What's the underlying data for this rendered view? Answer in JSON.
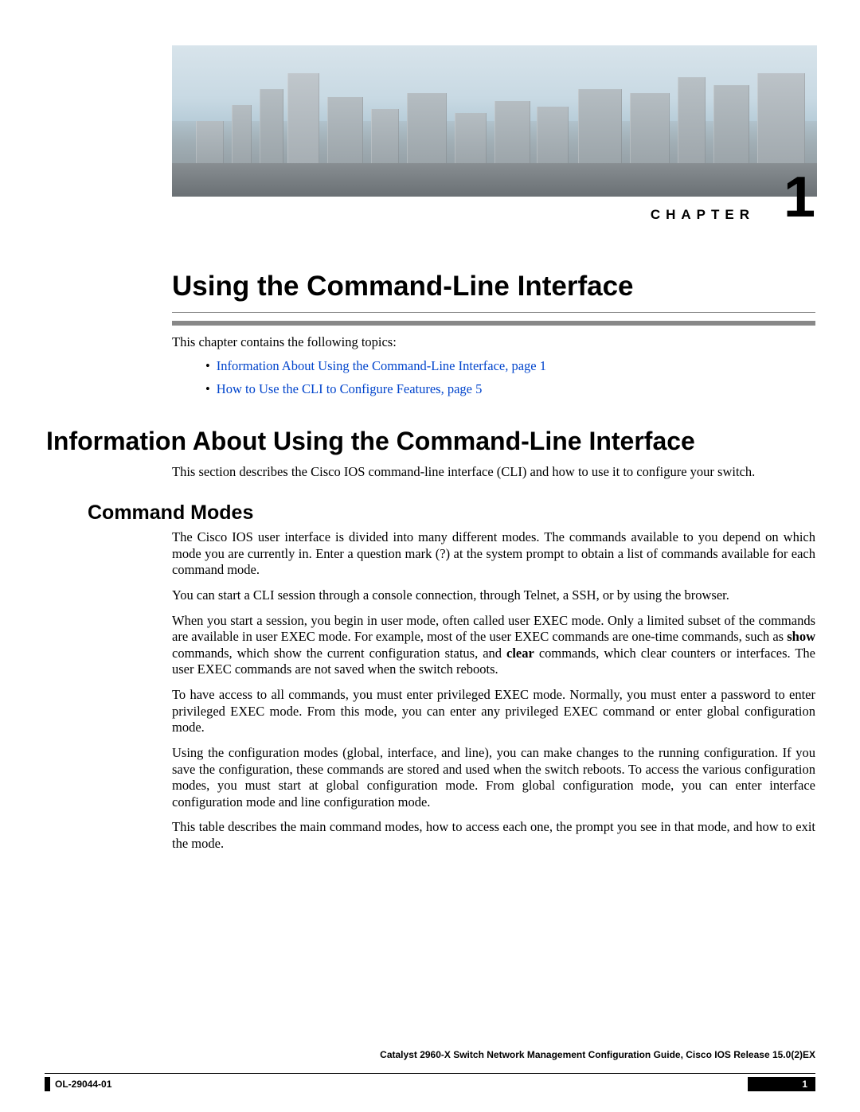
{
  "chapter": {
    "label": "CHAPTER",
    "number": "1",
    "title": "Using the Command-Line Interface"
  },
  "intro_text": "This chapter contains the following topics:",
  "toc": [
    {
      "text": "Information About Using the Command-Line Interface,  page  1"
    },
    {
      "text": "How to Use the CLI to Configure Features,  page  5"
    }
  ],
  "section1": {
    "heading": "Information About Using the Command-Line Interface",
    "intro": "This section describes the Cisco IOS command-line interface (CLI) and how to use it to configure your switch."
  },
  "subsection1": {
    "heading": "Command Modes",
    "p1": "The Cisco IOS user interface is divided into many different modes. The commands available to you depend on which mode you are currently in. Enter a question mark (?) at the system prompt to obtain a list of commands available for each command mode.",
    "p2": "You can start a CLI session through a console connection, through Telnet, a SSH, or by using the browser.",
    "p3_a": "When you start a session, you begin in user mode, often called user EXEC mode. Only a limited subset of the commands are available in user EXEC mode. For example, most of the user EXEC commands are one-time commands, such as ",
    "p3_show": "show",
    "p3_b": " commands, which show the current configuration status, and ",
    "p3_clear": "clear",
    "p3_c": " commands, which clear counters or interfaces. The user EXEC commands are not saved when the switch reboots.",
    "p4": "To have access to all commands, you must enter privileged EXEC mode. Normally, you must enter a password to enter privileged EXEC mode. From this mode, you can enter any privileged EXEC command or enter global configuration mode.",
    "p5": "Using the configuration modes (global, interface, and line), you can make changes to the running configuration. If you save the configuration, these commands are stored and used when the switch reboots. To access the various configuration modes, you must start at global configuration mode. From global configuration mode, you can enter interface configuration mode and line configuration mode.",
    "p6": "This table describes the main command modes, how to access each one, the prompt you see in that mode, and how to exit the mode."
  },
  "footer": {
    "guide_title": "Catalyst 2960-X Switch Network Management Configuration Guide, Cisco IOS Release 15.0(2)EX",
    "doc_id": "OL-29044-01",
    "page_number": "1"
  }
}
